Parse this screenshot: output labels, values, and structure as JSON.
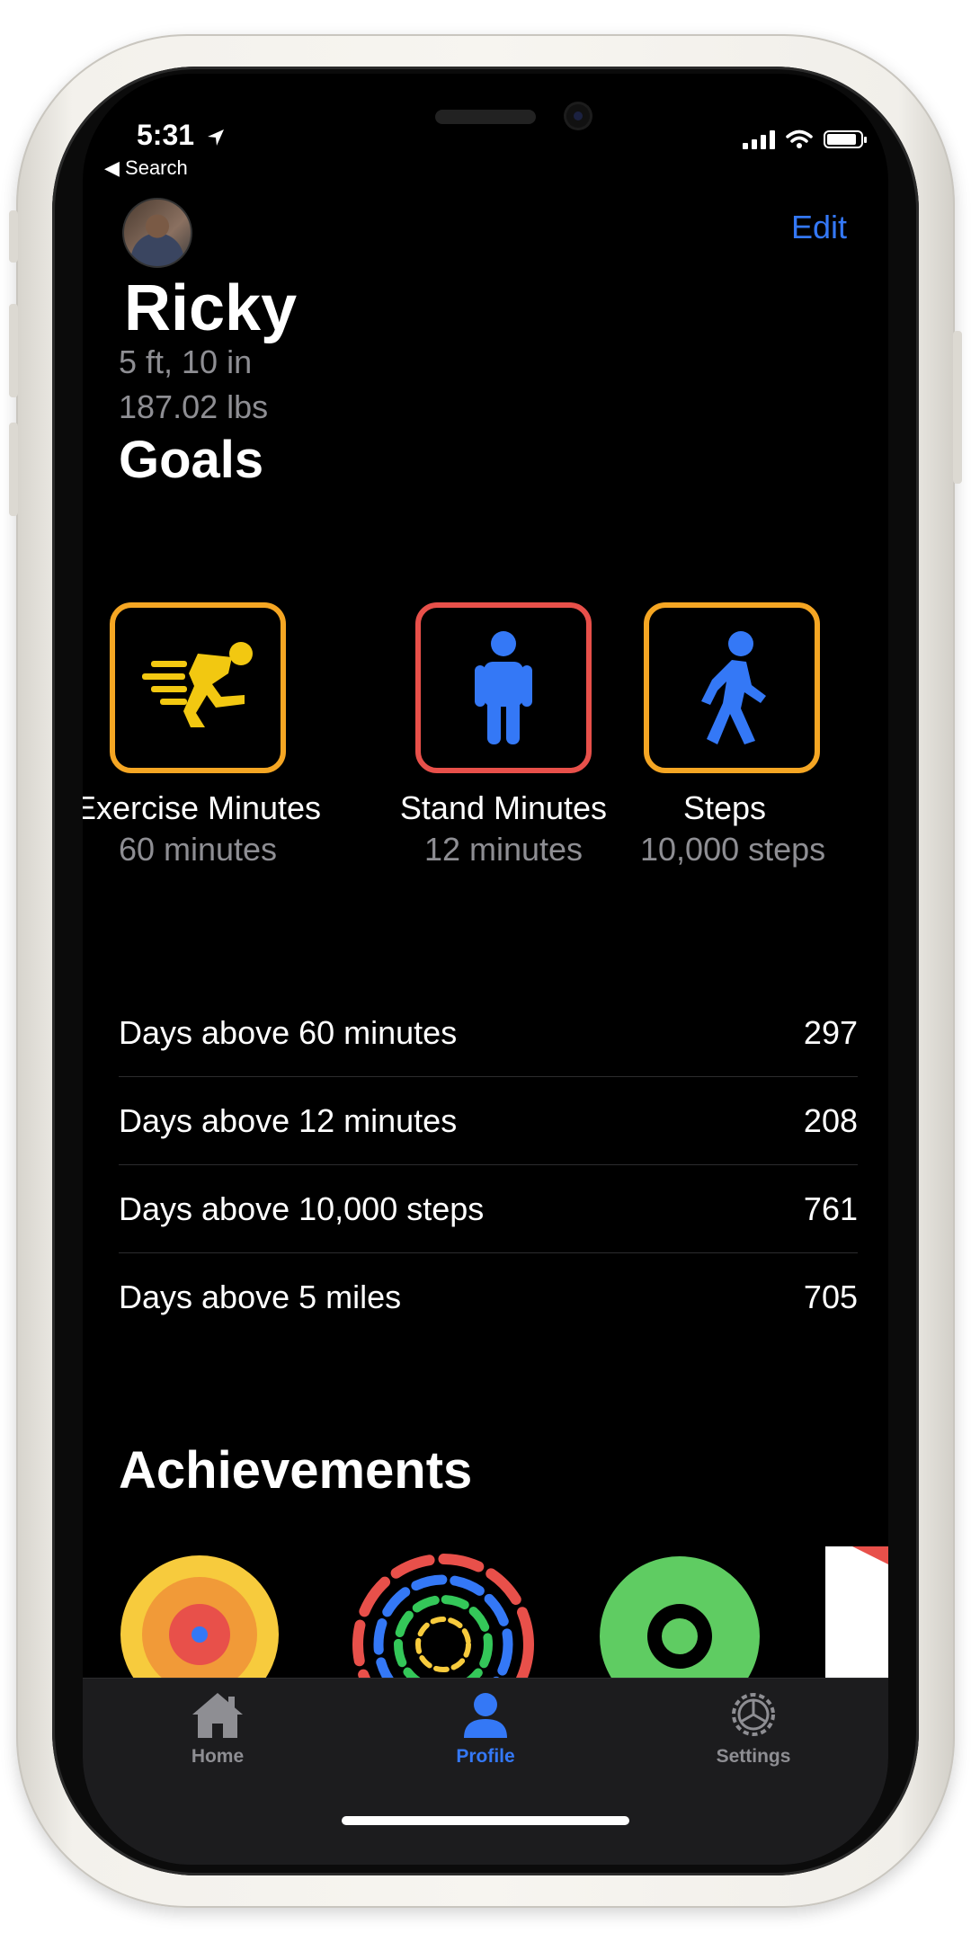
{
  "status": {
    "time": "5:31",
    "back": "◀ Search"
  },
  "header": {
    "edit": "Edit"
  },
  "profile": {
    "name": "Ricky",
    "height": "5 ft, 10 in",
    "weight": "187.02 lbs"
  },
  "sections": {
    "goals": "Goals",
    "achievements": "Achievements"
  },
  "goals": [
    {
      "label": "Exercise Minutes",
      "value": "60 minutes",
      "color": "#f5a623",
      "icon": "running-person-icon"
    },
    {
      "label": "Stand Minutes",
      "value": "12 minutes",
      "color": "#e8504a",
      "icon": "standing-person-icon"
    },
    {
      "label": "Steps",
      "value": "10,000 steps",
      "color": "#f5a623",
      "icon": "walking-person-icon"
    }
  ],
  "stats": [
    {
      "label": "Days above 60 minutes",
      "value": "297"
    },
    {
      "label": "Days above 12 minutes",
      "value": "208"
    },
    {
      "label": "Days above 10,000 steps",
      "value": "761"
    },
    {
      "label": "Days above 5 miles",
      "value": "705"
    }
  ],
  "tabs": [
    {
      "label": "Home",
      "icon": "house-icon",
      "active": false
    },
    {
      "label": "Profile",
      "icon": "person-icon",
      "active": true
    },
    {
      "label": "Settings",
      "icon": "gear-icon",
      "active": false
    }
  ],
  "colors": {
    "accent": "#3478f6",
    "inactive": "#8e8e93",
    "background": "#000000"
  }
}
